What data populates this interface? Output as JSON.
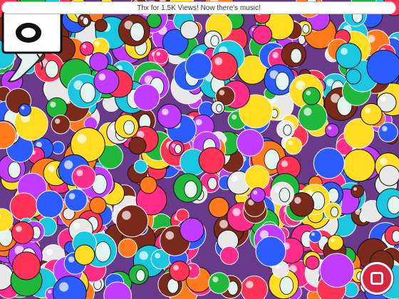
{
  "banner": {
    "text": "Thx for 1.5K Views! Now there's music!"
  },
  "colors": {
    "bubbles": [
      "#ff2d8a",
      "#1fb83a",
      "#2a5cff",
      "#ffdd22",
      "#ff7a1a",
      "#19c7e0",
      "#c23cff",
      "#e8e8e8",
      "#7a2a1a",
      "#ff3355"
    ],
    "stop_button": "#d7263d",
    "ghost_body": "#e4f2ee"
  },
  "icons": {
    "ghost": "ghost-sprite",
    "pen": "pen-icon",
    "camera": "camera-icon",
    "stop": "stop-icon"
  }
}
